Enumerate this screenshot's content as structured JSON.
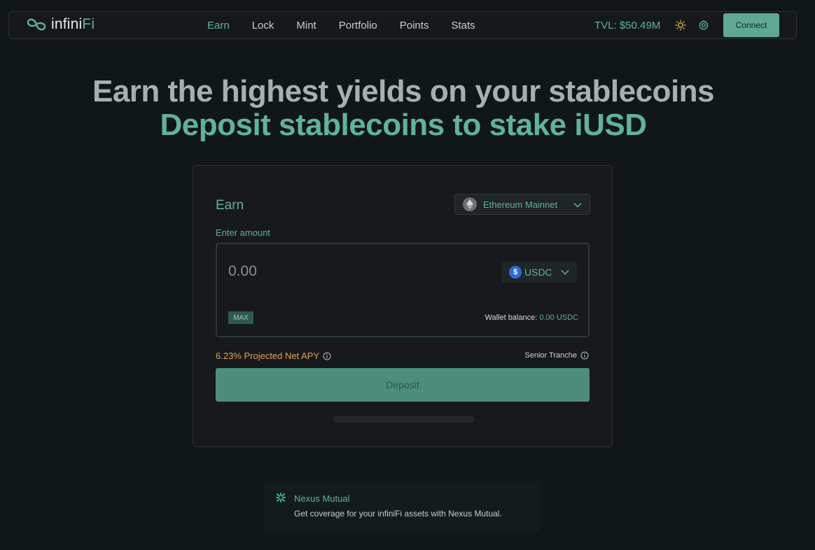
{
  "nav": {
    "logo_text_main": "infini",
    "logo_text_accent": "Fi",
    "links": [
      {
        "label": "Earn",
        "active": true
      },
      {
        "label": "Lock",
        "active": false
      },
      {
        "label": "Mint",
        "active": false
      },
      {
        "label": "Portfolio",
        "active": false
      },
      {
        "label": "Points",
        "active": false
      },
      {
        "label": "Stats",
        "active": false
      }
    ],
    "tvl": "TVL: $50.49M",
    "icons": [
      "sun-icon",
      "gear-icon"
    ],
    "connect_label": "Connect"
  },
  "hero": {
    "line1": "Earn the highest yields on your stablecoins",
    "line2": "Deposit stablecoins to stake iUSD"
  },
  "earn_card": {
    "title": "Earn",
    "network": "Ethereum Mainnet",
    "enter_amount_label": "Enter amount",
    "amount_placeholder": "0.00",
    "token": "USDC",
    "max_label": "MAX",
    "wallet_balance_label": "Wallet balance:",
    "wallet_balance_value": "0.00 USDC",
    "apy_text": "6.23% Projected Net APY",
    "tranche_text": "Senior Tranche",
    "deposit_label": "Deposit"
  },
  "nexus": {
    "title": "Nexus Mutual",
    "description": "Get coverage for your infiniFi assets with Nexus Mutual."
  },
  "colors": {
    "accent": "#5fb39a",
    "background": "#111618",
    "apy": "#e0a257",
    "button": "#5fa893"
  }
}
